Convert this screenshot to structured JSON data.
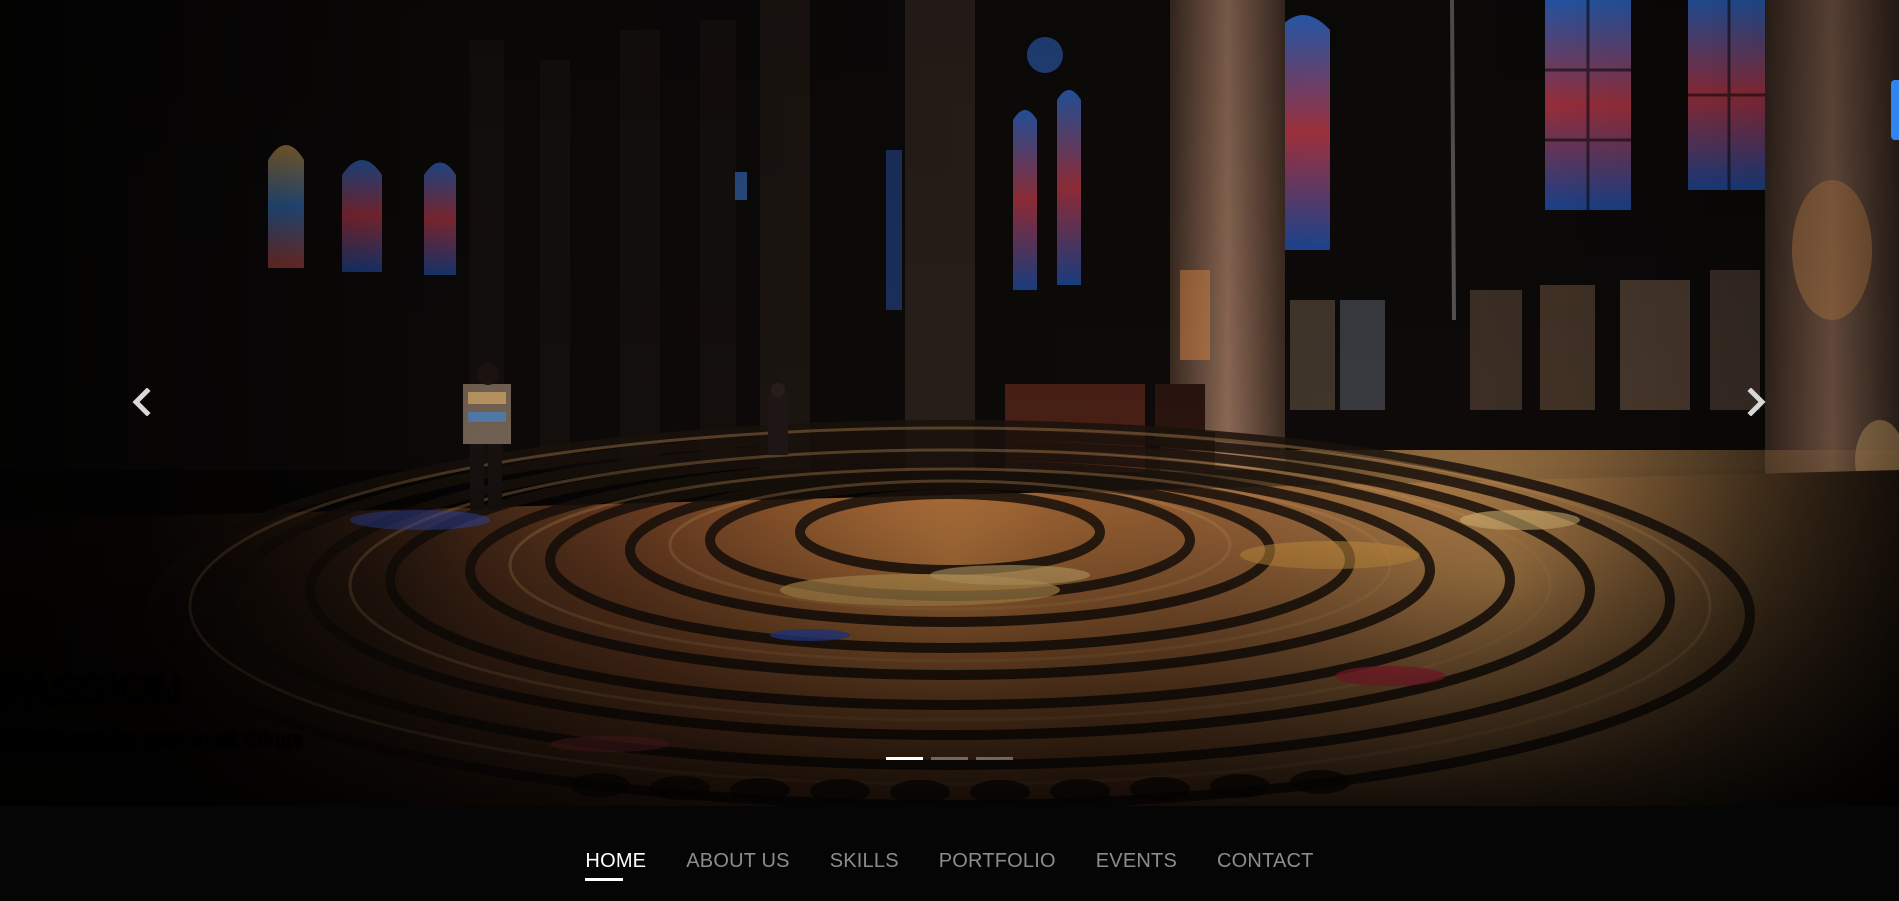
{
  "carousel": {
    "caption_title": "PASSION",
    "caption_subtitle": "Beauty can be seen in all things",
    "indicators": [
      {
        "active": true
      },
      {
        "active": false
      },
      {
        "active": false
      }
    ],
    "prev_icon": "chevron-left-icon",
    "next_icon": "chevron-right-icon"
  },
  "nav": {
    "items": [
      {
        "label": "HOME",
        "active": true
      },
      {
        "label": "ABOUT US",
        "active": false
      },
      {
        "label": "SKILLS",
        "active": false
      },
      {
        "label": "PORTFOLIO",
        "active": false
      },
      {
        "label": "EVENTS",
        "active": false
      },
      {
        "label": "CONTACT",
        "active": false
      }
    ]
  },
  "colors": {
    "nav_background": "#050505",
    "nav_active": "#ffffff",
    "nav_inactive": "#8c8c8c",
    "scroll_tab": "#2f86f0"
  }
}
